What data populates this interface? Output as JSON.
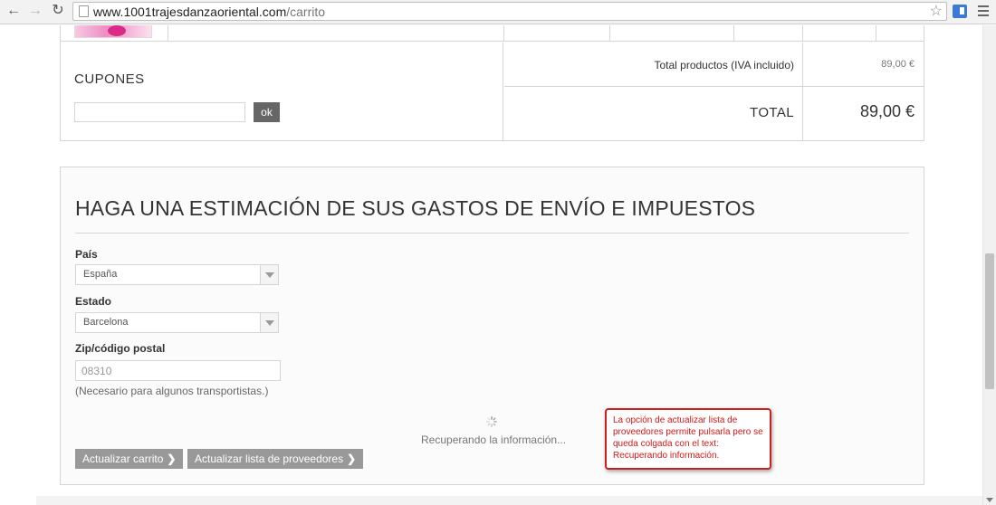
{
  "browser": {
    "url_host": "www.1001trajesdanzaoriental.com",
    "url_path": "/carrito"
  },
  "coupons": {
    "title": "CUPONES",
    "input_value": "",
    "ok_label": "ok"
  },
  "totals": {
    "products_label": "Total productos (IVA incluido)",
    "products_value": "89,00 €",
    "total_label": "TOTAL",
    "total_value": "89,00 €"
  },
  "shipping": {
    "title": "HAGA UNA ESTIMACIÓN DE SUS GASTOS DE ENVÍO E IMPUESTOS",
    "country_label": "País",
    "country_value": "España",
    "state_label": "Estado",
    "state_value": "Barcelona",
    "zip_label": "Zip/código postal",
    "zip_value": "08310",
    "zip_note": "(Necesario para algunos transportistas.)",
    "loading_text": "Recuperando la información...",
    "update_cart_label": "Actualizar carrito",
    "update_carriers_label": "Actualizar lista de proveedores"
  },
  "annotation": {
    "text": "La opción de actualizar lista de proveedores permite pulsarla pero se queda colgada con el text: Recuperando información.",
    "color": "#cc1f1f"
  },
  "icons": {
    "back": "back-arrow-icon",
    "forward": "forward-arrow-icon",
    "reload": "reload-icon",
    "star": "star-icon",
    "menu": "hamburger-menu-icon",
    "dropdown": "chevron-down-icon",
    "spinner": "loading-spinner-icon"
  }
}
